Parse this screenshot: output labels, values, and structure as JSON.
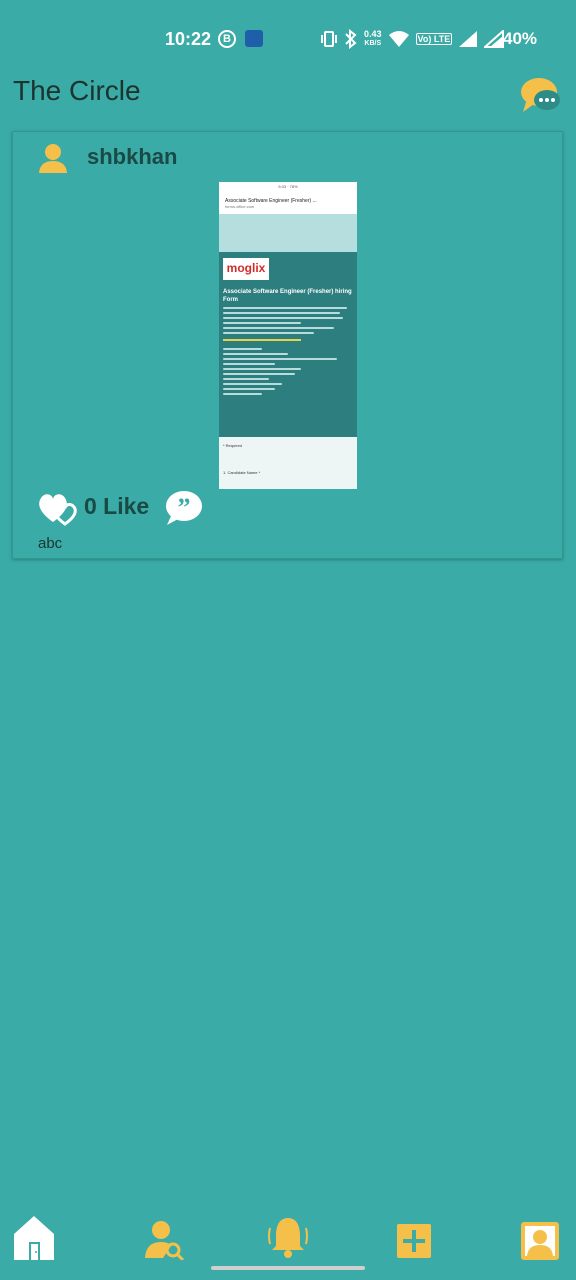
{
  "status_bar": {
    "time": "10:22",
    "b_badge": "B",
    "net_speed_value": "0.43",
    "net_speed_unit": "KB/S",
    "volte_label": "Vo) LTE",
    "battery": "40%"
  },
  "app_bar": {
    "title": "The Circle",
    "chat_icon": "chat-bubbles-icon"
  },
  "post": {
    "username": "shbkhan",
    "user_icon": "person-icon",
    "like_count_text": "0 Like",
    "caption": "abc",
    "image": {
      "time": "5:33",
      "battery": "78%",
      "url_title": "Associate Software Engineer (Fresher) ...",
      "url_domain": "forms.office.com",
      "logo": "moglix",
      "heading": "Associate Software Engineer (Fresher) hiring Form",
      "required_label": "* Required",
      "first_question": "1. Candidate Name *"
    }
  },
  "bottom_nav": {
    "items": [
      {
        "icon": "home-icon"
      },
      {
        "icon": "user-search-icon"
      },
      {
        "icon": "bell-icon"
      },
      {
        "icon": "add-icon"
      },
      {
        "icon": "profile-icon"
      }
    ]
  },
  "colors": {
    "background": "#3aaba6",
    "accent": "#f5c04a",
    "text_dark": "#1a4a46"
  }
}
